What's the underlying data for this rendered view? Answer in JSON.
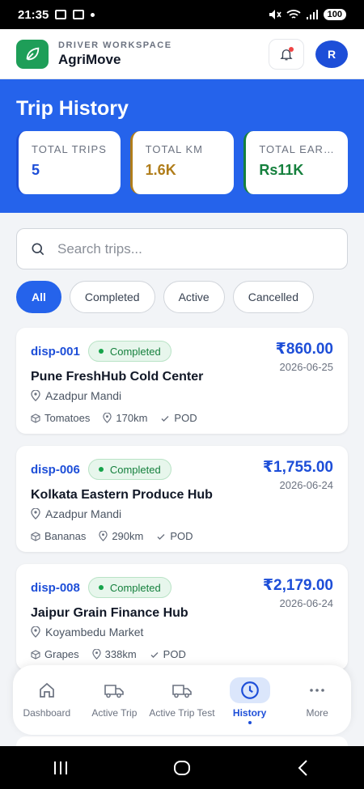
{
  "status_bar": {
    "time": "21:35",
    "battery": "100"
  },
  "app": {
    "kicker": "DRIVER WORKSPACE",
    "name": "AgriMove",
    "avatar_initial": "R"
  },
  "hero": {
    "title": "Trip History",
    "stats": [
      {
        "label": "TOTAL TRIPS",
        "value": "5"
      },
      {
        "label": "TOTAL KM",
        "value": "1.6K"
      },
      {
        "label": "TOTAL EARNINGS",
        "value": "Rs11K"
      }
    ]
  },
  "search": {
    "placeholder": "Search trips..."
  },
  "filters": [
    {
      "label": "All",
      "active": true
    },
    {
      "label": "Completed",
      "active": false
    },
    {
      "label": "Active",
      "active": false
    },
    {
      "label": "Cancelled",
      "active": false
    }
  ],
  "trips": [
    {
      "id": "disp-001",
      "status": "Completed",
      "amount": "₹860.00",
      "date": "2026-06-25",
      "destination": "Pune FreshHub Cold Center",
      "origin": "Azadpur Mandi",
      "produce": "Tomatoes",
      "distance": "170km",
      "pod": "POD"
    },
    {
      "id": "disp-006",
      "status": "Completed",
      "amount": "₹1,755.00",
      "date": "2026-06-24",
      "destination": "Kolkata Eastern Produce Hub",
      "origin": "Azadpur Mandi",
      "produce": "Bananas",
      "distance": "290km",
      "pod": "POD"
    },
    {
      "id": "disp-008",
      "status": "Completed",
      "amount": "₹2,179.00",
      "date": "2026-06-24",
      "destination": "Jaipur Grain Finance Hub",
      "origin": "Koyambedu Market",
      "produce": "Grapes",
      "distance": "338km",
      "pod": "POD"
    }
  ],
  "bottom_nav": [
    {
      "label": "Dashboard",
      "icon": "home-icon"
    },
    {
      "label": "Active Trip",
      "icon": "truck-icon"
    },
    {
      "label": "Active Trip Test",
      "icon": "truck-icon"
    },
    {
      "label": "History",
      "icon": "clock-icon",
      "active": true
    },
    {
      "label": "More",
      "icon": "more-icon"
    }
  ],
  "colors": {
    "primary": "#2563eb",
    "brand_green": "#1e9e58",
    "success": "#15803d",
    "km_accent": "#b07d1a"
  }
}
